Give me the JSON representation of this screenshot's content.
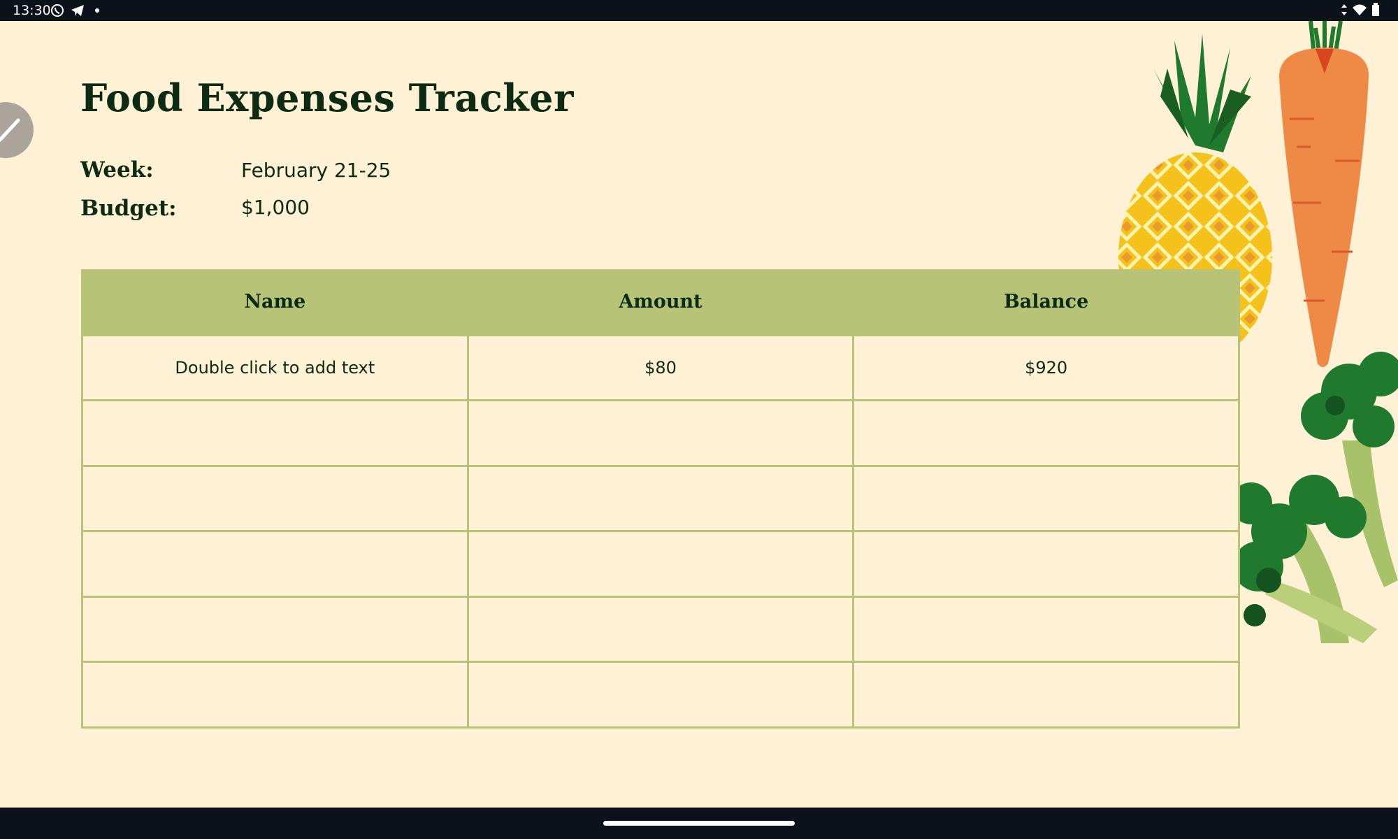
{
  "status_bar": {
    "time": "13:30",
    "left_icons": [
      "viber-icon",
      "telegram-icon",
      "dot-icon"
    ],
    "right_icons": [
      "data-arrows-icon",
      "wifi-icon",
      "battery-icon"
    ]
  },
  "document": {
    "title": "Food Expenses Tracker",
    "week_label": "Week:",
    "week_value": "February 21-25",
    "budget_label": "Budget:",
    "budget_value": "$1,000"
  },
  "table": {
    "headers": [
      "Name",
      "Amount",
      "Balance"
    ],
    "rows": [
      [
        "Double click to add text",
        "$80",
        "$920"
      ],
      [
        "",
        "",
        ""
      ],
      [
        "",
        "",
        ""
      ],
      [
        "",
        "",
        ""
      ],
      [
        "",
        "",
        ""
      ],
      [
        "",
        "",
        ""
      ]
    ]
  },
  "colors": {
    "background": "#fff1d6",
    "text": "#0d2b12",
    "table_accent": "#b7c477",
    "system_bar": "#0c121a"
  },
  "illustrations": [
    "pineapple-illustration",
    "carrot-illustration",
    "broccoli-illustration"
  ]
}
